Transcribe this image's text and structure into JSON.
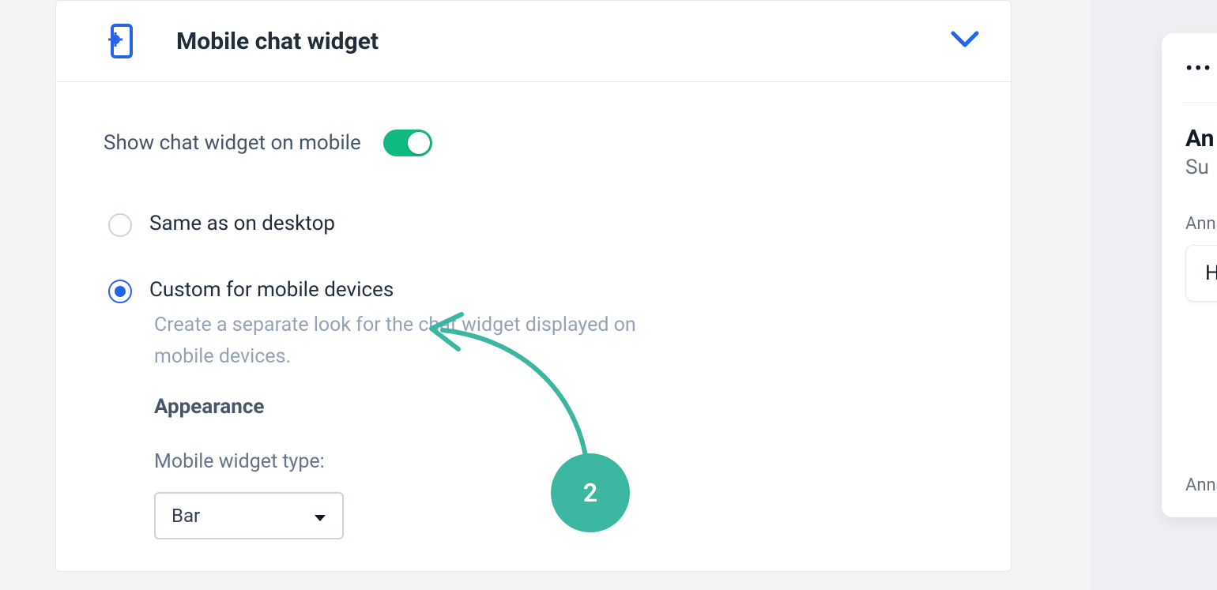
{
  "header": {
    "title": "Mobile chat widget"
  },
  "toggle": {
    "label": "Show chat widget on mobile",
    "on": true
  },
  "options": {
    "same": "Same as on desktop",
    "custom": "Custom for mobile devices",
    "custom_desc": "Create a separate look for the chat widget displayed on mobile devices."
  },
  "appearance": {
    "heading": "Appearance",
    "type_label": "Mobile widget type:",
    "type_value": "Bar"
  },
  "annotation": {
    "step": "2"
  },
  "preview": {
    "dots": "•••",
    "name": "An",
    "sub": "Su",
    "author1": "Anna",
    "bubble1": "H",
    "author2": "Anna"
  }
}
